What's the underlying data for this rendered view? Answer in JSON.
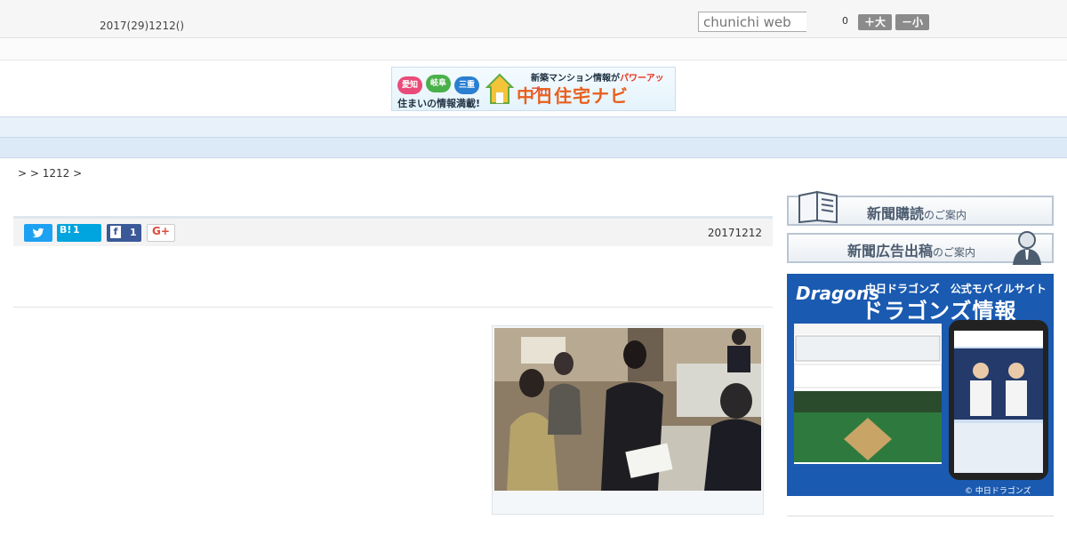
{
  "header": {
    "date": "2017(29)1212()",
    "search_placeholder": "chunichi web",
    "count": "0",
    "font_larger": "＋大",
    "font_smaller": "－小"
  },
  "banner": {
    "region1": "愛知",
    "region2": "岐阜",
    "region3": "三重",
    "tagline": "住まいの情報満載!",
    "headline": "新築マンション情報が",
    "headline_accent": "パワーアップ!!",
    "brand": "中日住宅ナビ"
  },
  "nav": {
    "items": [
      "",
      "",
      "",
      "",
      "",
      "",
      "",
      "",
      ""
    ]
  },
  "breadcrumb": {
    "text": ">  > 1212 >"
  },
  "article": {
    "date": "20171212",
    "hatena_label": "B!",
    "hatena_count": "1",
    "facebook_label": "f",
    "facebook_count": "1",
    "gplus_label": "G+"
  },
  "sidebar": {
    "subscribe_main": "新聞購読",
    "subscribe_sub": "のご案内",
    "ads_main": "新聞広告出稿",
    "ads_sub": "のご案内"
  },
  "promo": {
    "logo": "Dragons",
    "line1": "中日ドラゴンズ　公式モバイルサイト",
    "line2": "ドラゴンズ情報",
    "copyright": "© 中日ドラゴンズ"
  }
}
